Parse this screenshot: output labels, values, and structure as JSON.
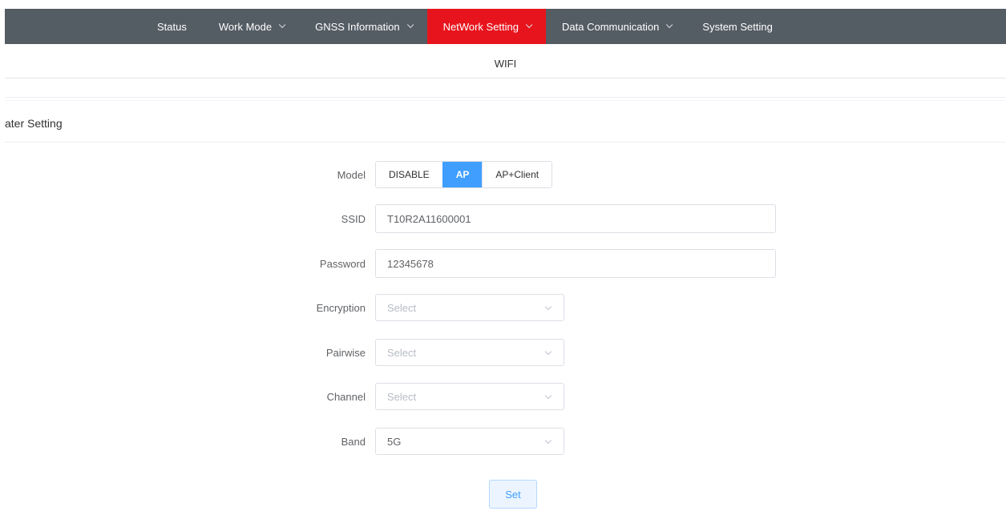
{
  "nav": {
    "items": [
      {
        "label": "Status",
        "has_arrow": false,
        "active": false
      },
      {
        "label": "Work Mode",
        "has_arrow": true,
        "active": false
      },
      {
        "label": "GNSS Information",
        "has_arrow": true,
        "active": false
      },
      {
        "label": "NetWork Setting",
        "has_arrow": true,
        "active": true
      },
      {
        "label": "Data Communication",
        "has_arrow": true,
        "active": false
      },
      {
        "label": "System Setting",
        "has_arrow": false,
        "active": false
      }
    ],
    "active_color": "#e8141d",
    "bar_color": "#545c64"
  },
  "subtabs": {
    "items": [
      "WIFI"
    ]
  },
  "section": {
    "title": "ater Setting"
  },
  "form": {
    "model": {
      "label": "Model",
      "options": [
        "DISABLE",
        "AP",
        "AP+Client"
      ],
      "selected": "AP"
    },
    "ssid": {
      "label": "SSID",
      "value": "T10R2A11600001"
    },
    "password": {
      "label": "Password",
      "value": "12345678"
    },
    "encryption": {
      "label": "Encryption",
      "value": "",
      "placeholder": "Select"
    },
    "pairwise": {
      "label": "Pairwise",
      "value": "",
      "placeholder": "Select"
    },
    "channel": {
      "label": "Channel",
      "value": "",
      "placeholder": "Select"
    },
    "band": {
      "label": "Band",
      "value": "5G",
      "placeholder": "Select"
    },
    "set_label": "Set"
  },
  "colors": {
    "primary": "#409eff"
  }
}
